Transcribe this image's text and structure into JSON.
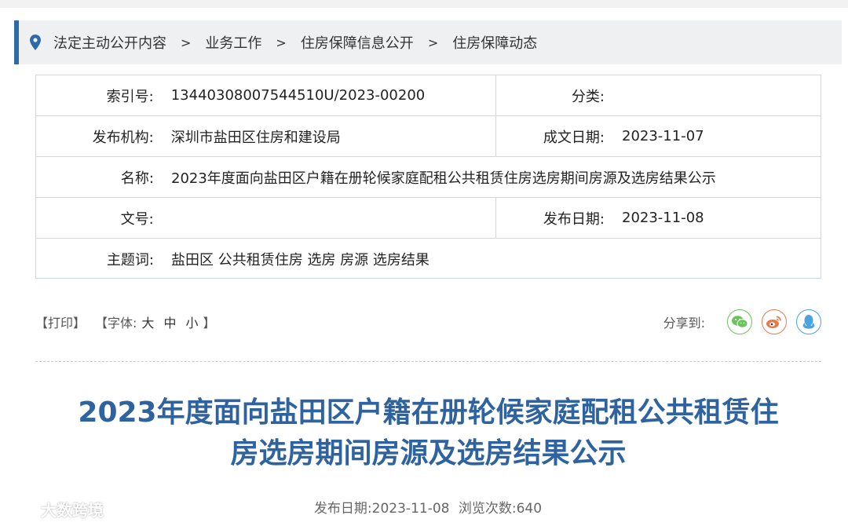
{
  "breadcrumb": {
    "items": [
      "法定主动公开内容",
      "业务工作",
      "住房保障信息公开",
      "住房保障动态"
    ],
    "separator": ">"
  },
  "meta": {
    "index_label": "索引号:",
    "index_value": "13440308007544510U/2023-00200",
    "category_label": "分类:",
    "category_value": "",
    "publisher_label": "发布机构:",
    "publisher_value": "深圳市盐田区住房和建设局",
    "created_label": "成文日期:",
    "created_value": "2023-11-07",
    "name_label": "名称:",
    "name_value": "2023年度面向盐田区户籍在册轮候家庭配租公共租赁住房选房期间房源及选房结果公示",
    "docno_label": "文号:",
    "docno_value": "",
    "published_label": "发布日期:",
    "published_value": "2023-11-08",
    "keywords_label": "主题词:",
    "keywords_value": "盐田区 公共租赁住房 选房 房源 选房结果"
  },
  "toolbar": {
    "print": "【打印】",
    "font_prefix": "【字体:",
    "font_large": "大",
    "font_medium": "中",
    "font_small": "小",
    "font_suffix": "】",
    "share_label": "分享到:"
  },
  "article": {
    "title_line1": "2023年度面向盐田区户籍在册轮候家庭配租公共租赁住",
    "title_line2": "房选房期间房源及选房结果公示",
    "pub_date": "发布日期:2023-11-08",
    "views": "浏览次数:640"
  },
  "watermark": {
    "text": "大数跨境"
  },
  "colors": {
    "accent": "#2e6aa8",
    "title": "#2e63a0",
    "wechat": "#6bc25a",
    "weibo": "#e87a4a",
    "qq": "#4aa3e0"
  },
  "icons": {
    "breadcrumb": "location-pin-icon",
    "wechat": "wechat-icon",
    "weibo": "weibo-icon",
    "qq": "qq-icon"
  }
}
